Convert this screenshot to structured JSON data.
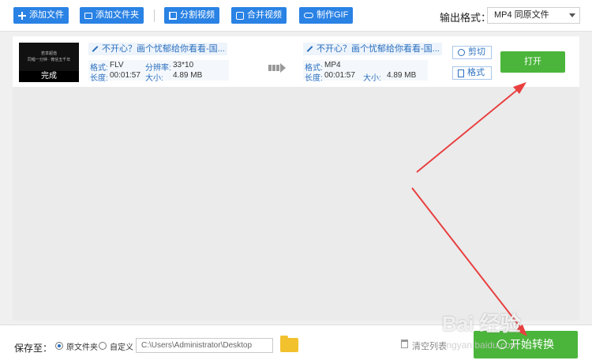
{
  "toolbar": {
    "add_file": "添加文件",
    "add_folder": "添加文件夹",
    "split_video": "分割视频",
    "merge_video": "合并视频",
    "make_gif": "制作GIF",
    "output_format_label": "输出格式：",
    "output_format_value": "MP4  同原文件"
  },
  "item": {
    "thumb_line1": "若享超值",
    "thumb_line2": "同唱一分钟 · 微信五千年",
    "status": "完成",
    "source": {
      "name": "不开心？画个忧郁给你看看-国...",
      "format_label": "格式:",
      "format": "FLV",
      "res_label": "分辨率:",
      "res": "33*10",
      "dur_label": "长度:",
      "duration": "00:01:57",
      "size_label": "大小:",
      "size": "4.89 MB"
    },
    "target": {
      "name": "不开心？画个忧郁给你看看-国...",
      "format_label": "格式:",
      "format": "MP4",
      "dur_label": "长度:",
      "duration": "00:01:57",
      "size_label": "大小:",
      "size": "4.89 MB"
    },
    "cut_label": "剪切",
    "format_btn_label": "格式",
    "open_label": "打开"
  },
  "bottom": {
    "save_to_label": "保存至：",
    "opt_original": "原文件夹",
    "opt_custom": "自定义",
    "path": "C:\\Users\\Administrator\\Desktop",
    "clear_list": "清空列表",
    "start_convert": "开始转换"
  },
  "watermark": {
    "text": "Bai 经验",
    "subtext": "jingyan.baidu.com"
  },
  "colors": {
    "primary": "#2a82e4",
    "green": "#4bb53b",
    "annotation": "#e84040"
  }
}
